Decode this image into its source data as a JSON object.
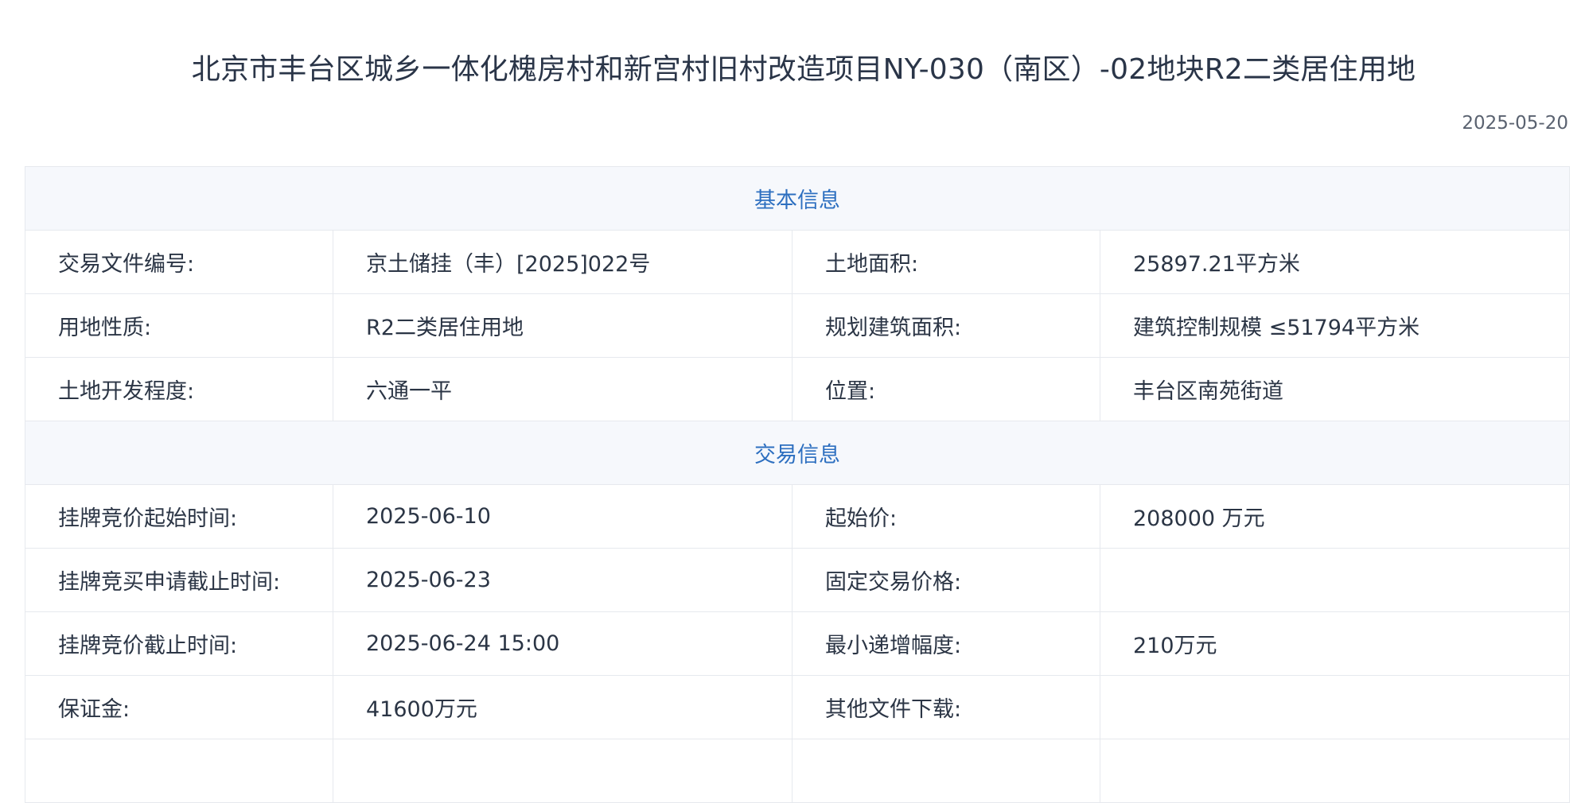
{
  "page": {
    "title": "北京市丰台区城乡一体化槐房村和新宫村旧村改造项目NY-030（南区）-02地块R2二类居住用地",
    "date": "2025-05-20"
  },
  "sections": {
    "basic": {
      "heading": "基本信息",
      "rows": [
        {
          "l1": "交易文件编号:",
          "v1": "京土储挂（丰）[2025]022号",
          "l2": "土地面积:",
          "v2": "25897.21平方米"
        },
        {
          "l1": "用地性质:",
          "v1": "R2二类居住用地",
          "l2": "规划建筑面积:",
          "v2": "建筑控制规模 ≤51794平方米"
        },
        {
          "l1": "土地开发程度:",
          "v1": "六通一平",
          "l2": "位置:",
          "v2": "丰台区南苑街道"
        }
      ]
    },
    "trade": {
      "heading": "交易信息",
      "rows": [
        {
          "l1": "挂牌竞价起始时间:",
          "v1": "2025-06-10",
          "l2": "起始价:",
          "v2": "208000 万元"
        },
        {
          "l1": "挂牌竞买申请截止时间:",
          "v1": "2025-06-23",
          "l2": "固定交易价格:",
          "v2": ""
        },
        {
          "l1": "挂牌竞价截止时间:",
          "v1": "2025-06-24 15:00",
          "l2": "最小递增幅度:",
          "v2": "210万元"
        },
        {
          "l1": "保证金:",
          "v1": "41600万元",
          "l2": "其他文件下载:",
          "v2": ""
        }
      ]
    }
  }
}
